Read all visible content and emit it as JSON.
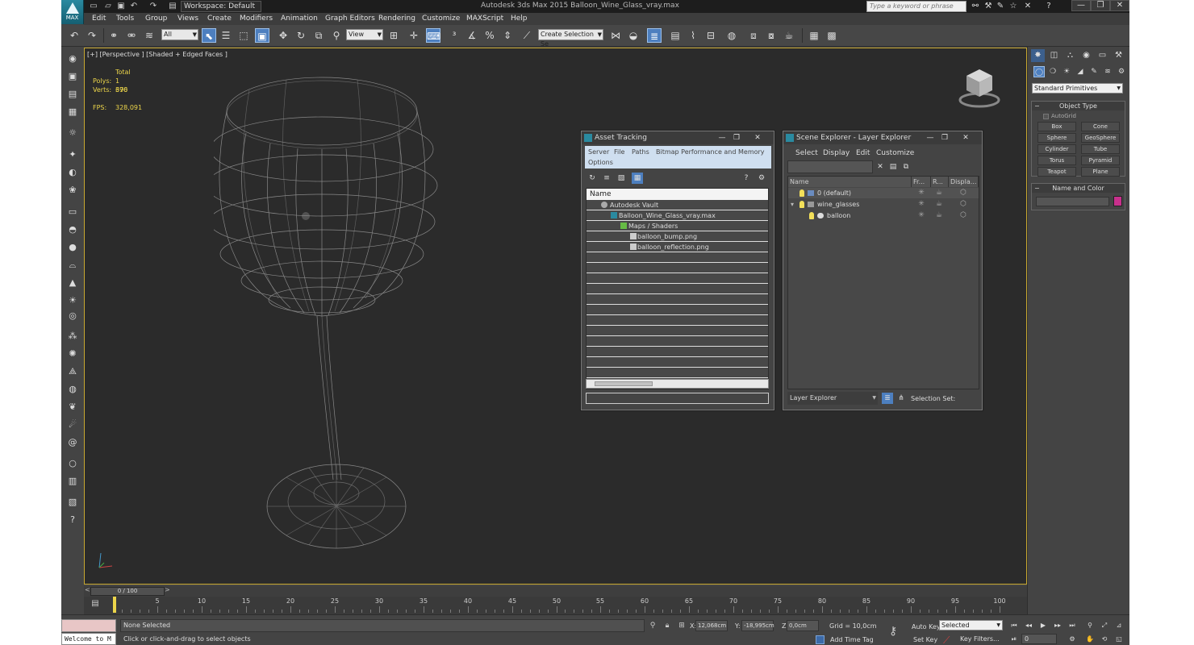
{
  "app": {
    "logo_text": "MAX",
    "window_title": "Autodesk 3ds Max 2015    Balloon_Wine_Glass_vray.max",
    "workspace": "Workspace: Default",
    "search_placeholder": "Type a keyword or phrase"
  },
  "menu": [
    "Edit",
    "Tools",
    "Group",
    "Views",
    "Create",
    "Modifiers",
    "Animation",
    "Graph Editors",
    "Rendering",
    "Customize",
    "MAXScript",
    "Help"
  ],
  "toolbar": {
    "selection_filter": "All",
    "ref_coord": "View",
    "named_selection": "Create Selection Se"
  },
  "viewport": {
    "label": "[+] [Perspective ] [Shaded + Edged Faces ]",
    "stats_header": "Total",
    "polys_label": "Polys:",
    "polys_value": "1 376",
    "verts_label": "Verts:",
    "verts_value": "690",
    "fps_label": "FPS:",
    "fps_value": "328,091"
  },
  "asset_tracking": {
    "title": "Asset Tracking",
    "menu": [
      "Server",
      "File",
      "Paths",
      "Bitmap Performance and Memory",
      "Options"
    ],
    "column": "Name",
    "rows": [
      "Autodesk Vault",
      "Balloon_Wine_Glass_vray.max",
      "Maps / Shaders",
      "balloon_bump.png",
      "balloon_reflection.png"
    ]
  },
  "scene_explorer": {
    "title": "Scene Explorer - Layer Explorer",
    "menu": [
      "Select",
      "Display",
      "Edit",
      "Customize"
    ],
    "columns": [
      "Name",
      "Fr...",
      "R...",
      "Displa..."
    ],
    "rows": [
      "0 (default)",
      "wine_glasses",
      "balloon"
    ],
    "explorer_dropdown": "Layer Explorer",
    "selection_set_label": "Selection Set:"
  },
  "command_panel": {
    "primitive_dropdown": "Standard Primitives",
    "object_type_title": "Object Type",
    "autogrid": "AutoGrid",
    "buttons": [
      "Box",
      "Cone",
      "Sphere",
      "GeoSphere",
      "Cylinder",
      "Tube",
      "Torus",
      "Pyramid",
      "Teapot",
      "Plane"
    ],
    "name_color_title": "Name and Color",
    "object_color": "#c8308c"
  },
  "timeline": {
    "frame_display": "0 / 100",
    "left_arrow": "<",
    "right_arrow": ">",
    "ticks": [
      "0",
      "5",
      "10",
      "15",
      "20",
      "25",
      "30",
      "35",
      "40",
      "45",
      "50",
      "55",
      "60",
      "65",
      "70",
      "75",
      "80",
      "85",
      "90",
      "95",
      "100"
    ]
  },
  "status": {
    "maxscript_text": "Welcome to M",
    "selection": "None Selected",
    "prompt": "Click or click-and-drag to select objects",
    "x_label": "X:",
    "x_value": "12,068cm",
    "y_label": "Y:",
    "y_value": "-18,995cm",
    "z_label": "Z:",
    "z_value": "0,0cm",
    "grid": "Grid = 10,0cm",
    "add_time_tag": "Add Time Tag",
    "auto_key": "Auto Key",
    "set_key": "Set Key",
    "key_mode": "Selected",
    "key_filters": "Key Filters...",
    "current_frame": "0"
  },
  "colors": {
    "viewport_bg": "#2b2b2b",
    "ui_bg": "#444444",
    "stats_text": "#ecd54a",
    "active_button": "#4d7fbf"
  }
}
